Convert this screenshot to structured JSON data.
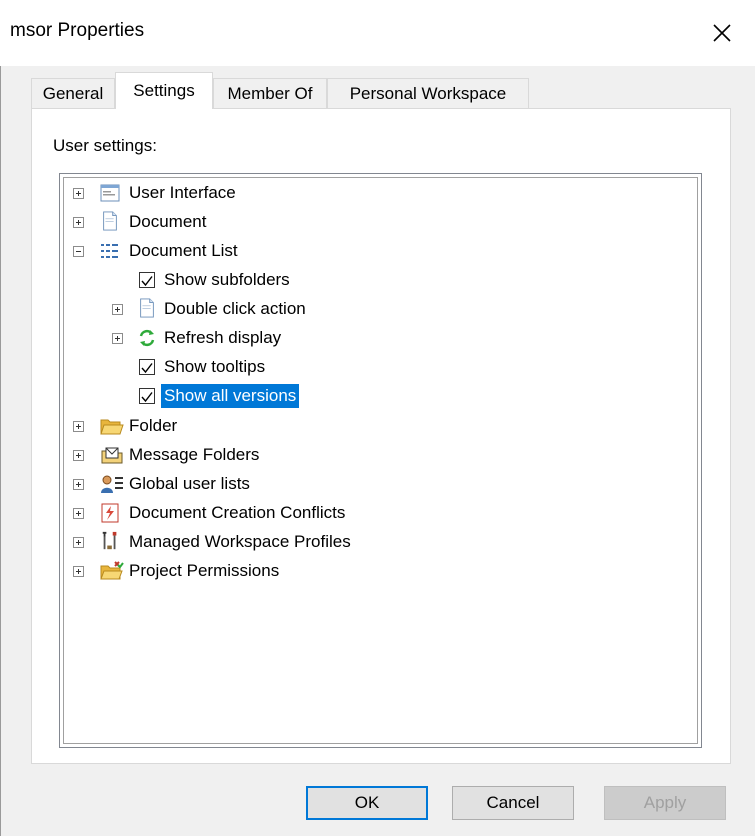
{
  "window": {
    "title": "msor Properties"
  },
  "tabs": [
    {
      "label": "General",
      "active": false
    },
    {
      "label": "Settings",
      "active": true
    },
    {
      "label": "Member Of",
      "active": false
    },
    {
      "label": "Personal Workspace",
      "active": false
    }
  ],
  "settings": {
    "heading": "User settings:"
  },
  "tree": {
    "user_interface": "User Interface",
    "document": "Document",
    "document_list": "Document List",
    "show_subfolders": "Show subfolders",
    "double_click_action": "Double click action",
    "refresh_display": "Refresh display",
    "show_tooltips": "Show tooltips",
    "show_all_versions": "Show all versions",
    "folder": "Folder",
    "message_folders": "Message Folders",
    "global_user_lists": "Global user lists",
    "document_creation_conflicts": "Document Creation Conflicts",
    "managed_workspace_profiles": "Managed Workspace Profiles",
    "project_permissions": "Project Permissions"
  },
  "buttons": {
    "ok": "OK",
    "cancel": "Cancel",
    "apply": "Apply"
  },
  "colors": {
    "selection": "#0078d7",
    "folder": "#f5c542",
    "refresh": "#2eaa3a"
  }
}
